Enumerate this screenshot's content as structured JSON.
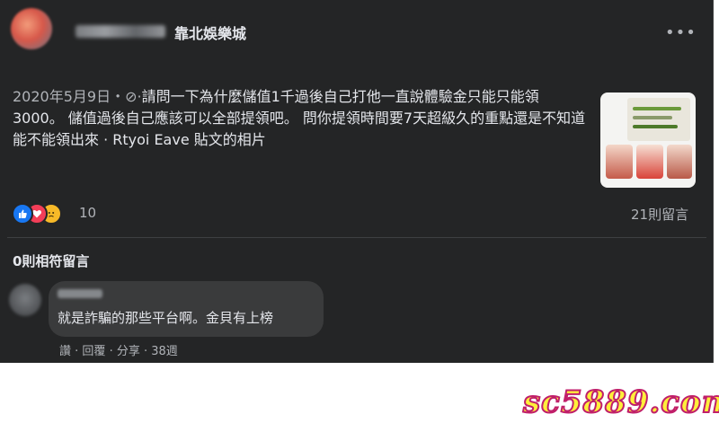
{
  "post": {
    "group_name": "靠北娛樂城",
    "more_label": "•••",
    "date": "2020年5月9日",
    "privacy_glyph": "·",
    "text": "請問一下為什麼儲值1千過後自己打他一直說體驗金只能只能領3000。 儲值過後自己應該可以全部提領吧。 問你提領時間要7天超級久的重點還是不知道能不能領出來 · Rtyoi Eave 貼文的相片"
  },
  "stats": {
    "reaction_count": "10",
    "comment_count": "21則留言",
    "reactions": [
      "like-icon",
      "love-icon",
      "sad-icon"
    ]
  },
  "comments_section": {
    "filter_label": "0則相符留言"
  },
  "comment": {
    "text": "就是詐騙的那些平台啊。金貝有上榜",
    "action_like": "讚",
    "action_reply": "回覆",
    "action_share": "分享",
    "time": "38週",
    "separator": " · "
  },
  "watermark": "sc5889.com",
  "colors": {
    "card_bg": "#242526",
    "text_primary": "#e4e6eb",
    "text_secondary": "#b0b3b8",
    "bubble_bg": "#3a3b3c",
    "like_blue": "#1877f2",
    "love_red": "#f33e58",
    "sad_yellow": "#f7b928",
    "watermark_fill": "#ffef3a",
    "watermark_stroke": "#c01f6a"
  }
}
